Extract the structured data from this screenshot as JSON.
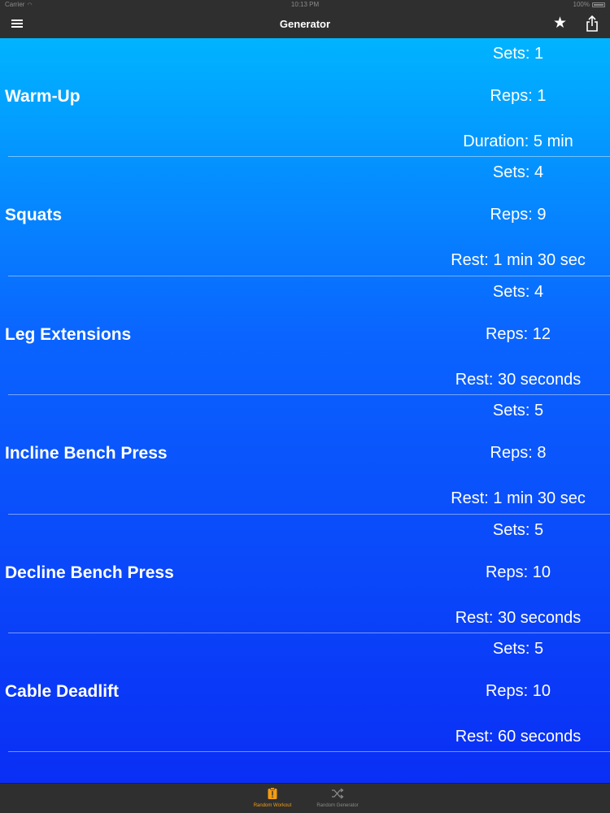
{
  "status_bar": {
    "carrier": "Carrier",
    "time": "10:13 PM",
    "battery": "100%"
  },
  "nav": {
    "title": "Generator",
    "menu_icon": "hamburger-menu-icon",
    "star_icon": "star-icon",
    "share_icon": "share-icon"
  },
  "exercises": [
    {
      "name": "Warm-Up",
      "line1": "Sets: 1",
      "line2": "Reps: 1",
      "line3": "Duration: 5 min"
    },
    {
      "name": "Squats",
      "line1": "Sets: 4",
      "line2": "Reps: 9",
      "line3": "Rest: 1 min 30 sec"
    },
    {
      "name": "Leg Extensions",
      "line1": "Sets: 4",
      "line2": "Reps: 12",
      "line3": "Rest: 30 seconds"
    },
    {
      "name": "Incline Bench Press",
      "line1": "Sets: 5",
      "line2": "Reps: 8",
      "line3": "Rest: 1 min 30 sec"
    },
    {
      "name": "Decline Bench Press",
      "line1": "Sets: 5",
      "line2": "Reps: 10",
      "line3": "Rest: 30 seconds"
    },
    {
      "name": "Cable Deadlift",
      "line1": "Sets: 5",
      "line2": "Reps: 10",
      "line3": "Rest: 60 seconds"
    }
  ],
  "tabs": [
    {
      "label": "Random Workout",
      "icon": "clipboard-icon",
      "active": true
    },
    {
      "label": "Random Generator",
      "icon": "shuffle-icon",
      "active": false
    }
  ],
  "colors": {
    "bar_background": "#2f2f2f",
    "gradient_top": "#00b4ff",
    "gradient_bottom": "#0a2ef5",
    "active_tab": "#f39c12",
    "inactive_tab": "#8a8a8a"
  }
}
